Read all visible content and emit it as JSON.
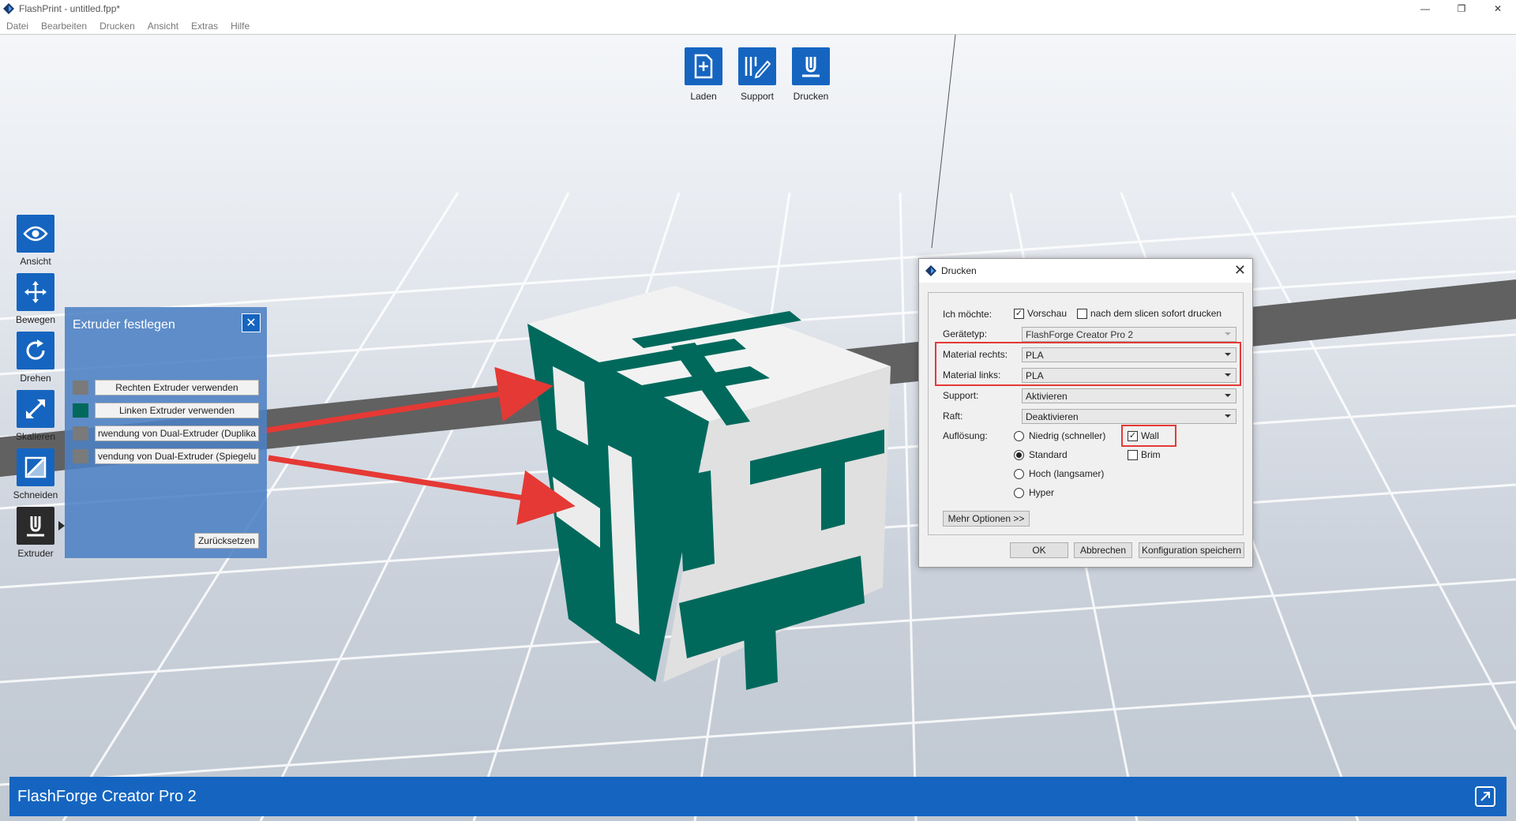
{
  "window": {
    "title": "FlashPrint - untitled.fpp*",
    "controls": [
      "—",
      "❐",
      "✕"
    ]
  },
  "menu": [
    "Datei",
    "Bearbeiten",
    "Drucken",
    "Ansicht",
    "Extras",
    "Hilfe"
  ],
  "top_toolbar": [
    {
      "label": "Laden",
      "icon": "load-file-icon"
    },
    {
      "label": "Support",
      "icon": "support-edit-icon"
    },
    {
      "label": "Drucken",
      "icon": "print-icon"
    }
  ],
  "left_tools": [
    {
      "label": "Ansicht",
      "icon": "eye-icon"
    },
    {
      "label": "Bewegen",
      "icon": "move-icon"
    },
    {
      "label": "Drehen",
      "icon": "rotate-icon"
    },
    {
      "label": "Skalieren",
      "icon": "scale-icon"
    },
    {
      "label": "Schneiden",
      "icon": "cut-icon"
    },
    {
      "label": "Extruder",
      "icon": "extruder-icon",
      "active": true
    }
  ],
  "extruder_panel": {
    "title": "Extruder festlegen",
    "options": [
      {
        "label": "Rechten Extruder verwenden",
        "swatch": "#7a7a7a"
      },
      {
        "label": "Linken Extruder verwenden",
        "swatch": "#00695c"
      },
      {
        "label": "rwendung von Dual-Extruder (Duplika",
        "swatch": "#7a7a7a"
      },
      {
        "label": "vendung von Dual-Extruder (Spiegelu",
        "swatch": "#7a7a7a"
      }
    ],
    "reset": "Zurücksetzen"
  },
  "dialog": {
    "title": "Drucken",
    "want_label": "Ich möchte:",
    "preview_label": "Vorschau",
    "preview_checked": true,
    "print_after_slice_label": "nach dem slicen sofort drucken",
    "print_after_slice_checked": false,
    "device_label": "Gerätetyp:",
    "device_value": "FlashForge Creator Pro 2",
    "material_right_label": "Material rechts:",
    "material_right_value": "PLA",
    "material_left_label": "Material links:",
    "material_left_value": "PLA",
    "support_label": "Support:",
    "support_value": "Aktivieren",
    "raft_label": "Raft:",
    "raft_value": "Deaktivieren",
    "resolution_label": "Auflösung:",
    "resolutions": [
      "Niedrig (schneller)",
      "Standard",
      "Hoch (langsamer)",
      "Hyper"
    ],
    "resolution_selected": "Standard",
    "wall_label": "Wall",
    "wall_checked": true,
    "brim_label": "Brim",
    "brim_checked": false,
    "more_options": "Mehr Optionen >>",
    "ok": "OK",
    "cancel": "Abbrechen",
    "save_config": "Konfiguration speichern"
  },
  "status": {
    "printer": "FlashForge Creator Pro 2"
  },
  "colors": {
    "accent": "#1565c0",
    "teal": "#00695c",
    "highlight": "#e53935"
  }
}
